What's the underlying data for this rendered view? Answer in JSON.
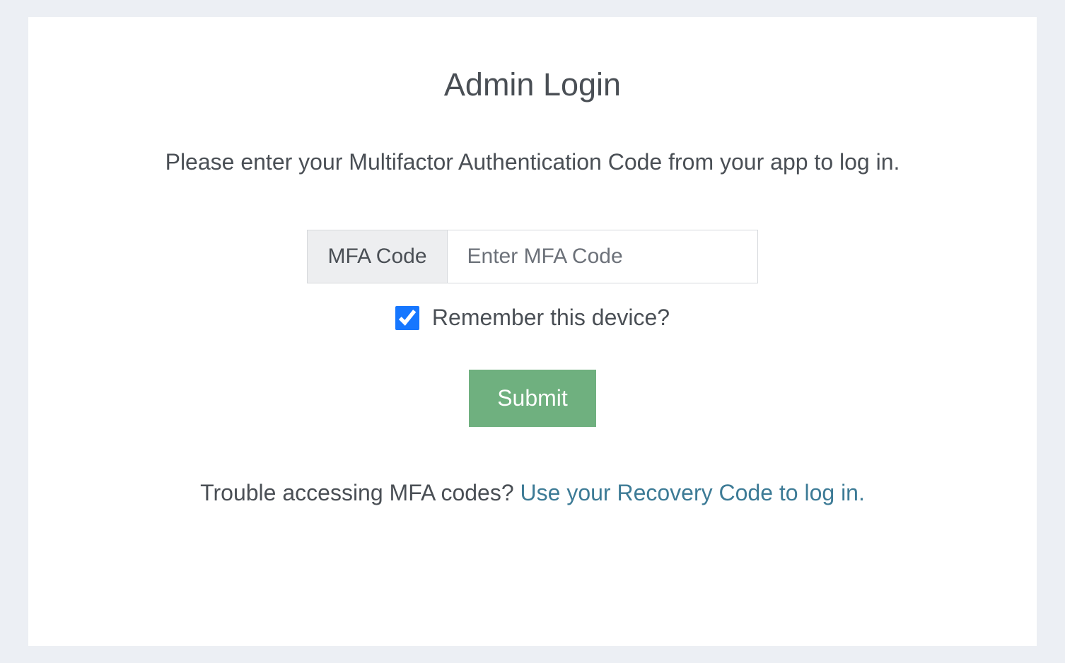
{
  "title": "Admin Login",
  "subtitle": "Please enter your Multifactor Authentication Code from your app to log in.",
  "mfa": {
    "label": "MFA Code",
    "placeholder": "Enter MFA Code",
    "value": ""
  },
  "remember": {
    "label": "Remember this device?",
    "checked": true
  },
  "submit_label": "Submit",
  "trouble_text": "Trouble accessing MFA codes? ",
  "recovery_link_text": "Use your Recovery Code to log in."
}
